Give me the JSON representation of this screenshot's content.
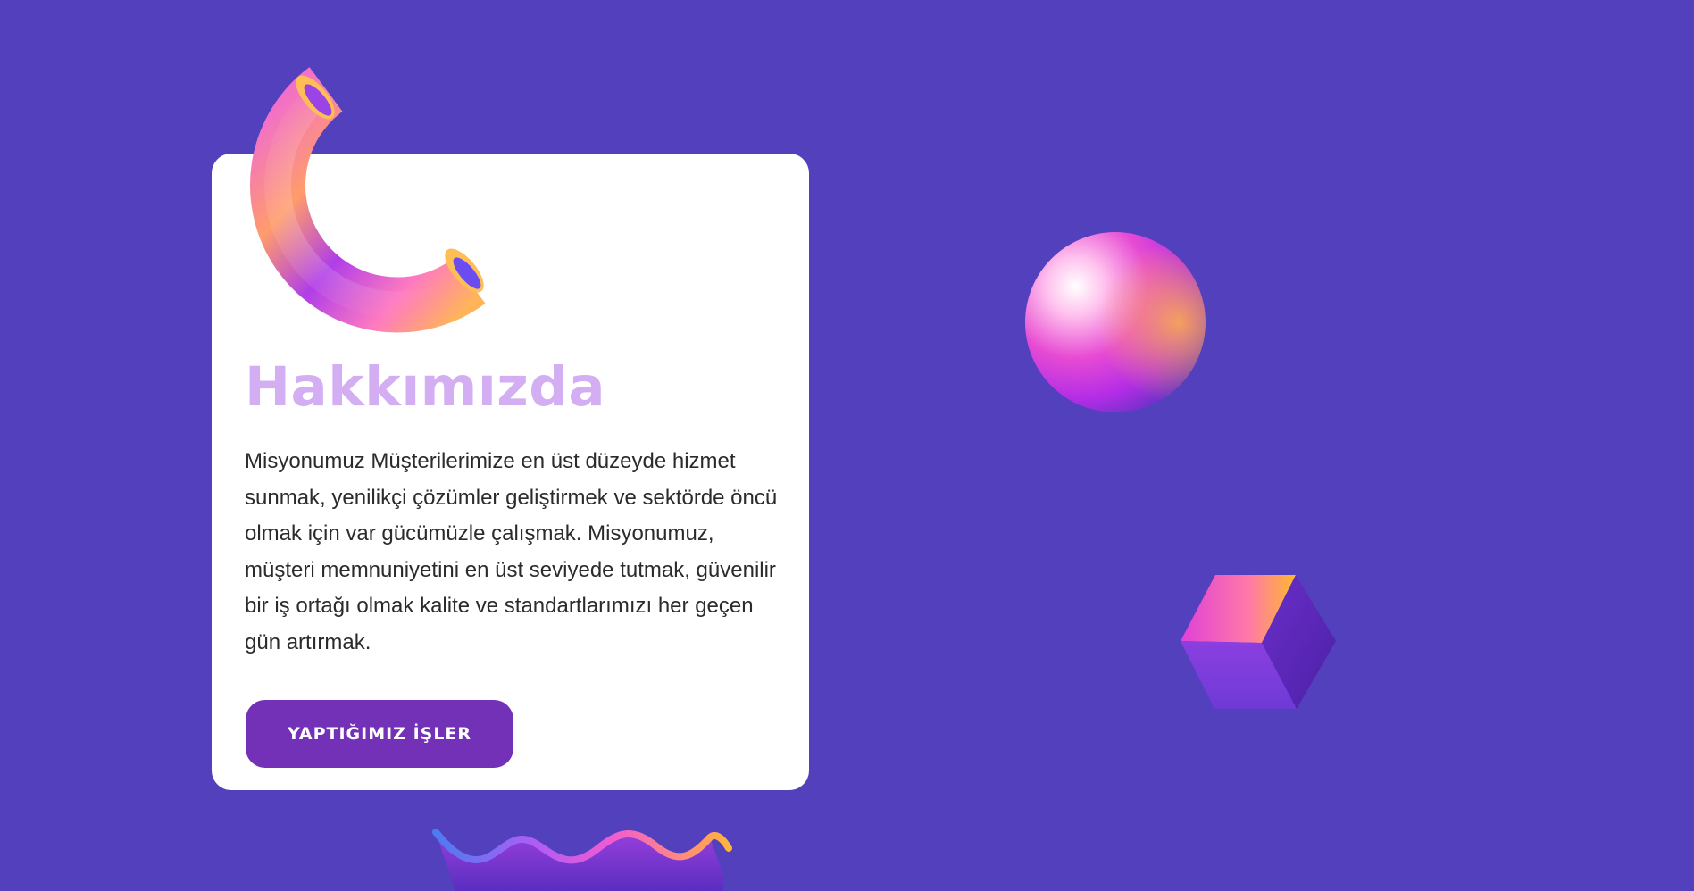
{
  "about": {
    "title": "Hakkımızda",
    "description": "Misyonumuz Müşterilerimize en üst düzeyde hizmet sunmak, yenilikçi çözümler geliştirmek ve sektörde öncü olmak için var gücümüzle çalışmak. Misyonumuz, müşteri memnuniyetini en üst seviyede tutmak, güvenilir bir iş ortağı olmak  kalite ve standartlarımızı her geçen gün artırmak.",
    "button_label": "YAPTIĞIMIZ İŞLER"
  },
  "decorations": {
    "torus": "torus-arc-3d-icon",
    "sphere": "gradient-sphere-3d-icon",
    "cube": "gradient-cube-3d-icon",
    "wave": "wave-ribbon-3d-icon"
  },
  "colors": {
    "background": "#5240bc",
    "card": "#ffffff",
    "title": "#d4aef3",
    "text": "#2b2b2b",
    "button": "#7331b8",
    "button_text": "#ffffff"
  }
}
